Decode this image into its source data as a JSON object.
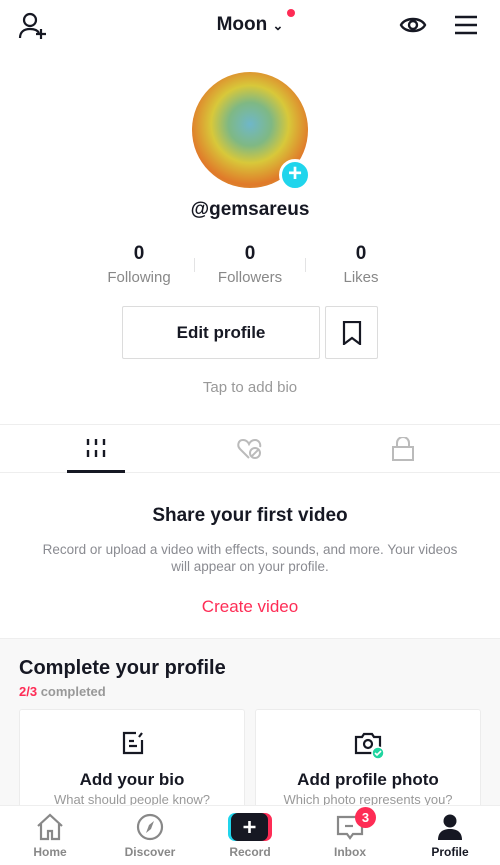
{
  "header": {
    "title": "Moon",
    "add_user_icon": "person-plus-icon",
    "eye_icon": "eye-icon",
    "menu_icon": "hamburger-icon",
    "notification_dot_color": "#fe2c55"
  },
  "profile": {
    "handle": "@gemsareus",
    "stats": [
      {
        "value": "0",
        "label": "Following"
      },
      {
        "value": "0",
        "label": "Followers"
      },
      {
        "value": "0",
        "label": "Likes"
      }
    ],
    "edit_label": "Edit profile",
    "bio_placeholder": "Tap to add bio"
  },
  "tabs": [
    {
      "icon": "grid-icon",
      "active": true
    },
    {
      "icon": "liked-hidden-icon"
    },
    {
      "icon": "lock-icon"
    }
  ],
  "empty": {
    "title": "Share your first video",
    "text": "Record or upload a video with effects, sounds, and more. Your videos will appear on your profile.",
    "cta": "Create video"
  },
  "complete": {
    "title": "Complete your profile",
    "done": "2/3",
    "suffix": "completed",
    "cards": [
      {
        "title": "Add your bio",
        "subtitle": "What should people know?"
      },
      {
        "title": "Add profile photo",
        "subtitle": "Which photo represents you?"
      }
    ]
  },
  "nav": [
    {
      "label": "Home"
    },
    {
      "label": "Discover"
    },
    {
      "label": "Record"
    },
    {
      "label": "Inbox",
      "badge": "3"
    },
    {
      "label": "Profile",
      "active": true
    }
  ],
  "colors": {
    "accent": "#fe2c55",
    "cyan": "#20d5ec",
    "text": "#161823"
  }
}
